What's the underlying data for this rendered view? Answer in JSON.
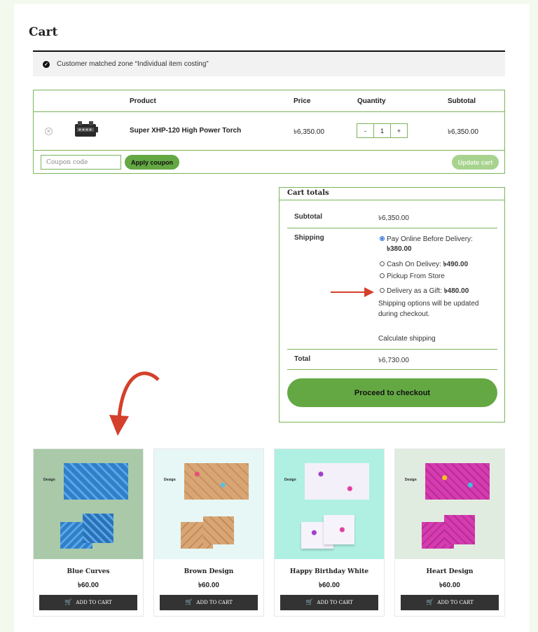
{
  "page": {
    "title": "Cart"
  },
  "notice": {
    "text": "Customer matched zone “Individual item costing”"
  },
  "cart_table": {
    "headers": {
      "product": "Product",
      "price": "Price",
      "quantity": "Quantity",
      "subtotal": "Subtotal"
    },
    "item": {
      "name": "Super XHP-120 High Power Torch",
      "price": "৳6,350.00",
      "quantity": "1",
      "subtotal": "৳6,350.00",
      "minus": "-",
      "plus": "+"
    },
    "coupon_placeholder": "Coupon code",
    "apply_coupon": "Apply coupon",
    "update_cart": "Update cart"
  },
  "totals": {
    "heading": "Cart totals",
    "subtotal_label": "Subtotal",
    "subtotal_value": "৳6,350.00",
    "shipping_label": "Shipping",
    "options": [
      {
        "label": "Pay Online Before Delivery:",
        "price": "৳380.00",
        "selected": true
      },
      {
        "label": "Cash On Delivey:",
        "price": "৳490.00",
        "selected": false
      },
      {
        "label": "Pickup From Store",
        "price": "",
        "selected": false
      },
      {
        "label": "Delivery as a Gift:",
        "price": "৳480.00",
        "selected": false
      }
    ],
    "shipping_note": "Shipping options will be updated during checkout.",
    "calculate_shipping": "Calculate shipping",
    "total_label": "Total",
    "total_value": "৳6,730.00",
    "proceed": "Proceed to checkout"
  },
  "products": [
    {
      "name": "Blue Curves",
      "price": "৳60.00",
      "button": "ADD TO CART",
      "design_label": "Design",
      "bg": "#a9c9a9",
      "color": "#2f7fc9"
    },
    {
      "name": "Brown Design",
      "price": "৳60.00",
      "button": "ADD TO CART",
      "design_label": "Design",
      "bg": "#e6f7f6",
      "color": "#d8a674"
    },
    {
      "name": "Happy Birthday White",
      "price": "৳60.00",
      "button": "ADD TO CART",
      "design_label": "Design",
      "bg": "#aff0e3",
      "color": "#f2eef8"
    },
    {
      "name": "Heart Design",
      "price": "৳60.00",
      "button": "ADD TO CART",
      "design_label": "Design",
      "bg": "#e1ece0",
      "color": "#d63bb0"
    }
  ],
  "colors": {
    "accent": "#64a844",
    "border": "#7ab55c",
    "arrow": "#d4402b",
    "page_bg": "#f3f9ec"
  },
  "icons": {
    "notice": "check-circle-icon",
    "remove": "remove-icon",
    "cart": "cart-icon"
  }
}
